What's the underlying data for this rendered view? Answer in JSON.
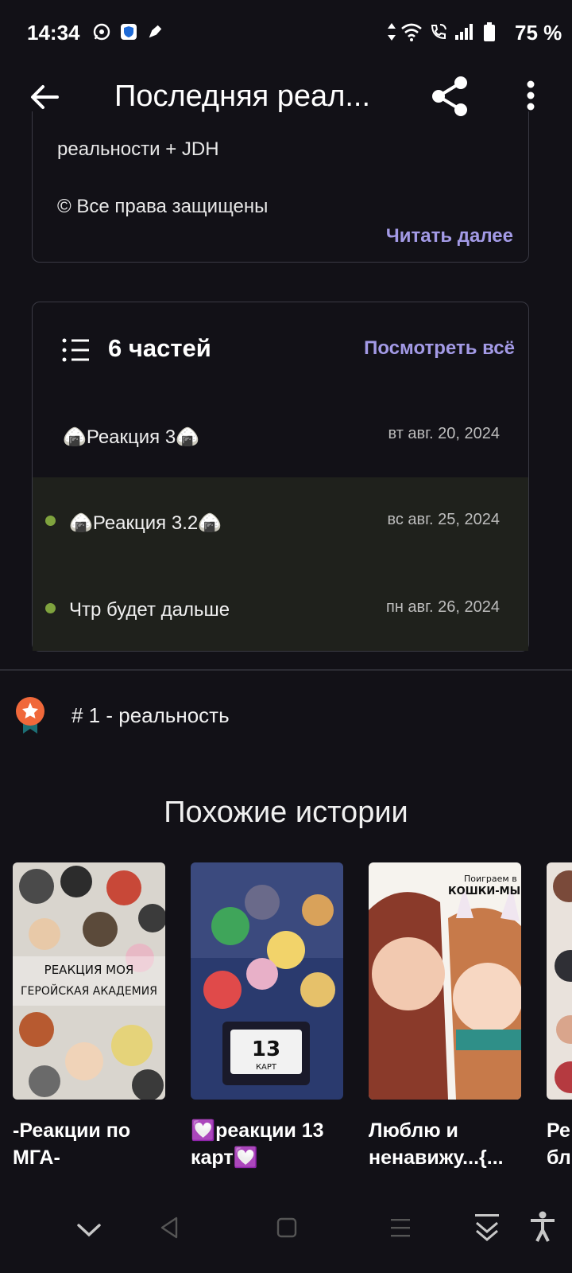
{
  "status_bar": {
    "time": "14:34",
    "battery": "75 %"
  },
  "app_bar": {
    "title": "Последняя реал..."
  },
  "description": {
    "line1": "реальности + JDH",
    "line2": "© Все права защищены",
    "read_more": "Читать далее"
  },
  "parts": {
    "title": "6 частей",
    "see_all": "Посмотреть всё",
    "items": [
      {
        "title": "🍙Реакция 3🍙",
        "date": "вт авг. 20, 2024",
        "new": false
      },
      {
        "title": "🍙Реакция 3.2🍙",
        "date": "вс авг. 25, 2024",
        "new": true
      },
      {
        "title": "Чтр будет дальше",
        "date": "пн авг. 26, 2024",
        "new": true
      }
    ]
  },
  "ranking": {
    "text": "# 1 - реальность"
  },
  "similar": {
    "heading": "Похожие истории",
    "stories": [
      {
        "title": "-Реакции по МГА-",
        "cover_text_1": "РЕАКЦИЯ МОЯ",
        "cover_text_2": "ГЕРОЙСКАЯ АКАДЕМИЯ"
      },
      {
        "title": "💟реакции 13 карт💟",
        "cover_text_1": "13",
        "cover_text_2": "КАРТ"
      },
      {
        "title": "Люблю и ненавижу...{...",
        "cover_text_1": "Поиграем в",
        "cover_text_2": "КОШКИ-МЫШ"
      },
      {
        "title": "Ре бл"
      }
    ]
  },
  "colors": {
    "background": "#121117",
    "accent": "#a39ae6",
    "new_dot": "#7fa33e",
    "badge": "#f0683a"
  }
}
